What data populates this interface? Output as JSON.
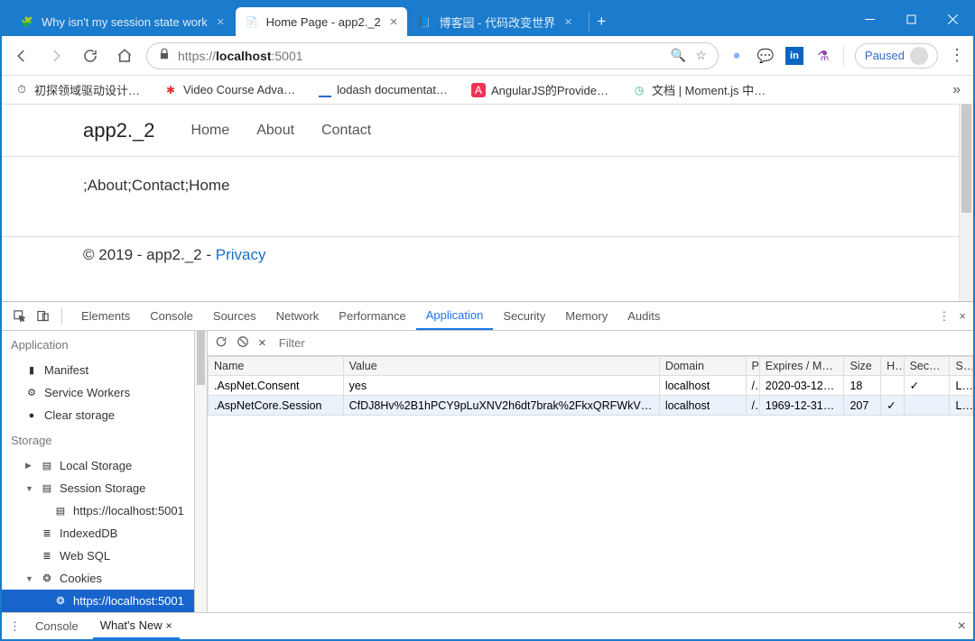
{
  "window": {
    "tabs": [
      {
        "title": "Why isn't my session state work",
        "active": false
      },
      {
        "title": "Home Page - app2._2",
        "active": true
      },
      {
        "title": "博客园 - 代码改变世界",
        "active": false
      }
    ]
  },
  "toolbar": {
    "url_scheme": "https://",
    "url_host": "localhost",
    "url_rest": ":5001",
    "paused_label": "Paused"
  },
  "bookmarks": [
    "初探领域驱动设计…",
    "Video Course Adva…",
    "lodash documentat…",
    "AngularJS的Provide…",
    "文档 | Moment.js 中…"
  ],
  "page": {
    "brand": "app2._2",
    "nav": [
      "Home",
      "About",
      "Contact"
    ],
    "body_text": ";About;Contact;Home",
    "footer_prefix": "© 2019 - app2._2 - ",
    "footer_link": "Privacy"
  },
  "devtools": {
    "tabs": [
      "Elements",
      "Console",
      "Sources",
      "Network",
      "Performance",
      "Application",
      "Security",
      "Memory",
      "Audits"
    ],
    "active_tab": "Application",
    "sidebar": {
      "application_label": "Application",
      "app_items": [
        "Manifest",
        "Service Workers",
        "Clear storage"
      ],
      "storage_label": "Storage",
      "storage_items": [
        {
          "label": "Local Storage",
          "expanded": false
        },
        {
          "label": "Session Storage",
          "expanded": true,
          "children": [
            "https://localhost:5001"
          ]
        },
        {
          "label": "IndexedDB"
        },
        {
          "label": "Web SQL"
        },
        {
          "label": "Cookies",
          "expanded": true,
          "children": [
            "https://localhost:5001"
          ],
          "selected_child": 0
        }
      ]
    },
    "filter_placeholder": "Filter",
    "columns": [
      "Name",
      "Value",
      "Domain",
      "P",
      "Expires / Max…",
      "Size",
      "H…",
      "Secure",
      "S…"
    ],
    "rows": [
      {
        "name": ".AspNet.Consent",
        "value": "yes",
        "domain": "localhost",
        "path": "/",
        "expires": "2020-03-12T…",
        "size": "18",
        "http": "",
        "secure": "✓",
        "same": "La"
      },
      {
        "name": ".AspNetCore.Session",
        "value": "CfDJ8Hv%2B1hPCY9pLuXNV2h6dt7brak%2FkxQRFWkVkQh…",
        "domain": "localhost",
        "path": "/",
        "expires": "1969-12-31T…",
        "size": "207",
        "http": "✓",
        "secure": "",
        "same": "La"
      }
    ],
    "drawer_tabs": [
      "Console",
      "What's New"
    ],
    "drawer_active": "What's New"
  }
}
